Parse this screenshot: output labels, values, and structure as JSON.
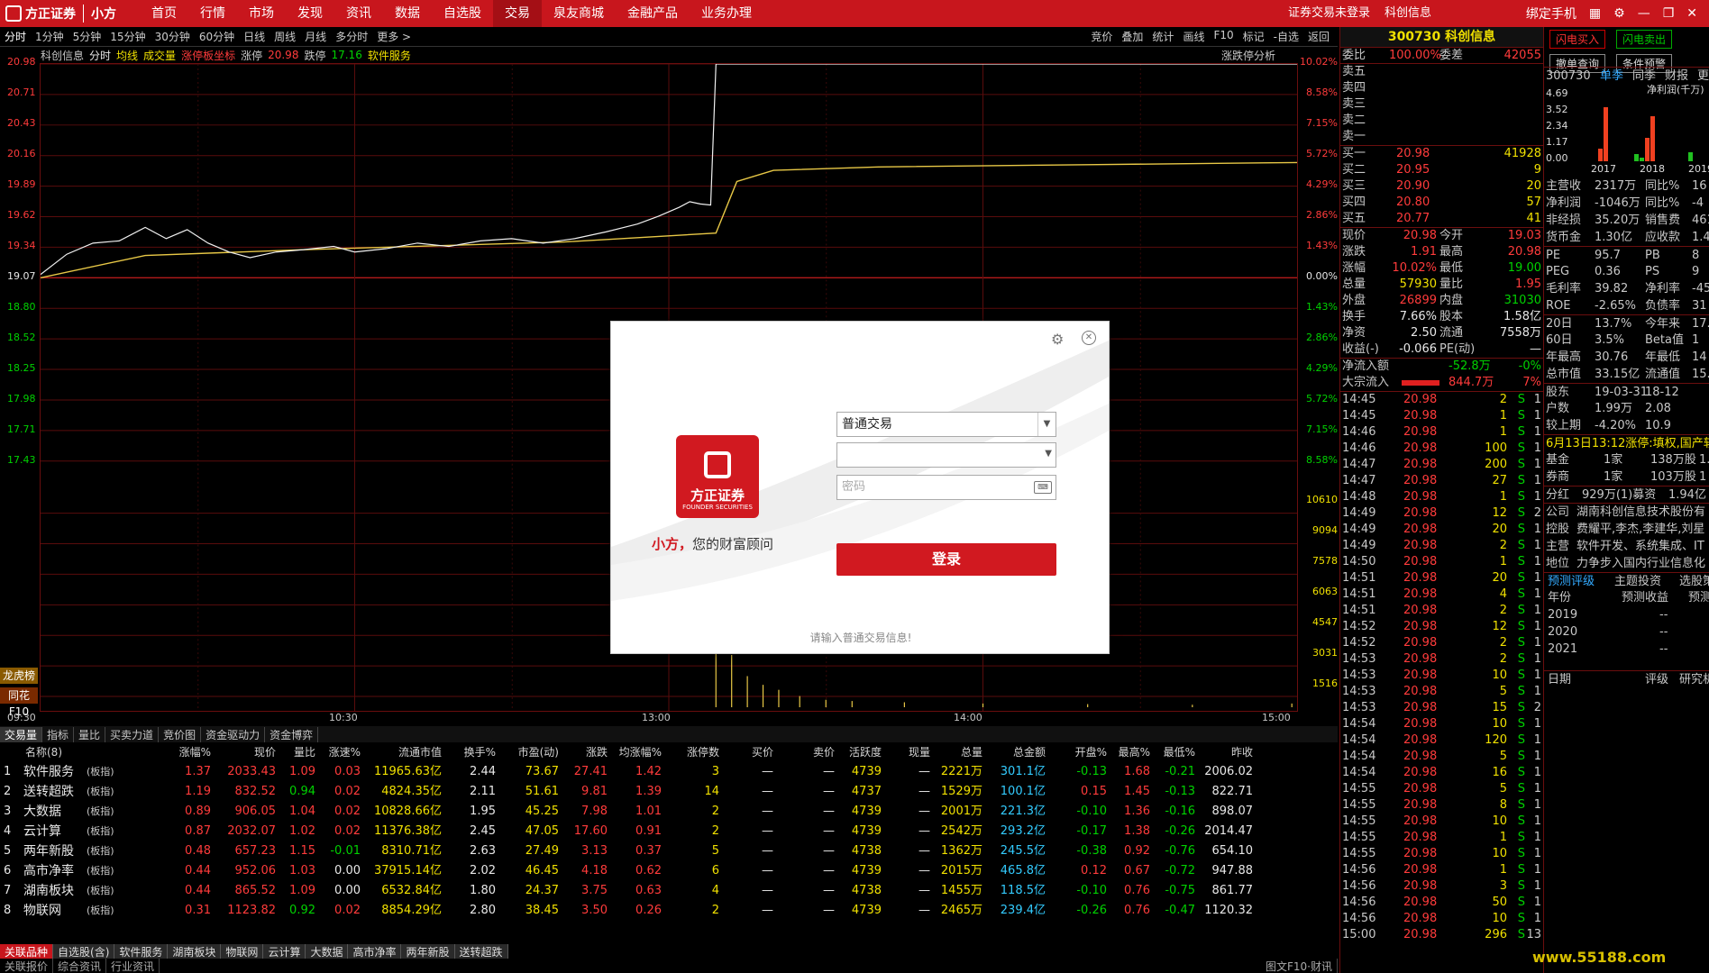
{
  "brand": {
    "name": "方正证券",
    "sub": "小方"
  },
  "nav": [
    "首页",
    "行情",
    "市场",
    "发现",
    "资讯",
    "数据",
    "自选股",
    "交易",
    "泉友商城",
    "金融产品",
    "业务办理"
  ],
  "nav_active": 7,
  "top_right": [
    "证券交易未登录",
    "科创信息"
  ],
  "win_right": "绑定手机",
  "toolbar": [
    "分时",
    "1分钟",
    "5分钟",
    "15分钟",
    "30分钟",
    "60分钟",
    "日线",
    "周线",
    "月线",
    "多分时",
    "更多 >"
  ],
  "toolbar_right": [
    "竞价",
    "叠加",
    "统计",
    "画线",
    "F10",
    "标记",
    "-自选",
    "返回"
  ],
  "infoline": {
    "a": "科创信息",
    "b": "分时",
    "c": "均线",
    "d": "成交量",
    "e": "涨停板坐标",
    "f": "涨停",
    "g": "20.98",
    "h": "跌停",
    "i": "17.16",
    "j": "软件服务",
    "k": "涨跌停分析"
  },
  "price_labels": [
    "20.98",
    "20.71",
    "20.43",
    "20.16",
    "19.89",
    "19.62",
    "19.34",
    "19.07",
    "18.80",
    "18.52",
    "18.25",
    "17.98",
    "17.71",
    "17.43"
  ],
  "pct_labels": [
    "10.02%",
    "8.58%",
    "7.15%",
    "5.72%",
    "4.29%",
    "2.86%",
    "1.43%",
    "0.00%",
    "1.43%",
    "2.86%",
    "4.29%",
    "5.72%",
    "7.15%",
    "8.58%"
  ],
  "vol_labels": [
    "10610",
    "9094",
    "7578",
    "6063",
    "4547",
    "3031",
    "1516"
  ],
  "time_labels": [
    "09:30",
    "10:30",
    "13:00",
    "14:00",
    "15:00"
  ],
  "side_badges": [
    "龙虎榜",
    "同花F10"
  ],
  "subtabs": [
    "交易量",
    "指标",
    "量比",
    "买卖力道",
    "竞价图",
    "资金驱动力",
    "资金博弈"
  ],
  "table": {
    "headers": [
      "名称(8)",
      "涨幅%",
      "现价",
      "量比",
      "涨速%",
      "流通市值",
      "换手%",
      "市盈(动)",
      "涨跌",
      "均涨幅%",
      "涨停数",
      "买价",
      "卖价",
      "活跃度",
      "现量",
      "总量",
      "总金额",
      "开盘%",
      "最高%",
      "最低%",
      "昨收"
    ],
    "rows": [
      [
        "1",
        "软件服务",
        "(板指)",
        "1.37",
        "2033.43",
        "1.09",
        "0.03",
        "11965.63亿",
        "2.44",
        "73.67",
        "27.41",
        "1.42",
        "3",
        "—",
        "—",
        "4739",
        "—",
        "2221万",
        "301.1亿",
        "-0.13",
        "1.68",
        "-0.21",
        "2006.02"
      ],
      [
        "2",
        "送转超跌",
        "(板指)",
        "1.19",
        "832.52",
        "0.94",
        "0.02",
        "4824.35亿",
        "2.11",
        "51.61",
        "9.81",
        "1.39",
        "14",
        "—",
        "—",
        "4737",
        "—",
        "1529万",
        "100.1亿",
        "0.15",
        "1.45",
        "-0.13",
        "822.71"
      ],
      [
        "3",
        "大数据",
        "(板指)",
        "0.89",
        "906.05",
        "1.04",
        "0.02",
        "10828.66亿",
        "1.95",
        "45.25",
        "7.98",
        "1.01",
        "2",
        "—",
        "—",
        "4739",
        "—",
        "2001万",
        "221.3亿",
        "-0.10",
        "1.36",
        "-0.16",
        "898.07"
      ],
      [
        "4",
        "云计算",
        "(板指)",
        "0.87",
        "2032.07",
        "1.02",
        "0.02",
        "11376.38亿",
        "2.45",
        "47.05",
        "17.60",
        "0.91",
        "2",
        "—",
        "—",
        "4739",
        "—",
        "2542万",
        "293.2亿",
        "-0.17",
        "1.38",
        "-0.26",
        "2014.47"
      ],
      [
        "5",
        "两年新股",
        "(板指)",
        "0.48",
        "657.23",
        "1.15",
        "-0.01",
        "8310.71亿",
        "2.63",
        "27.49",
        "3.13",
        "0.37",
        "5",
        "—",
        "—",
        "4738",
        "—",
        "1362万",
        "245.5亿",
        "-0.38",
        "0.92",
        "-0.76",
        "654.10"
      ],
      [
        "6",
        "高市净率",
        "(板指)",
        "0.44",
        "952.06",
        "1.03",
        "0.00",
        "37915.14亿",
        "2.02",
        "46.45",
        "4.18",
        "0.62",
        "6",
        "—",
        "—",
        "4739",
        "—",
        "2015万",
        "465.8亿",
        "0.12",
        "0.67",
        "-0.72",
        "947.88"
      ],
      [
        "7",
        "湖南板块",
        "(板指)",
        "0.44",
        "865.52",
        "1.09",
        "0.00",
        "6532.84亿",
        "1.80",
        "24.37",
        "3.75",
        "0.63",
        "4",
        "—",
        "—",
        "4738",
        "—",
        "1455万",
        "118.5亿",
        "-0.10",
        "0.76",
        "-0.75",
        "861.77"
      ],
      [
        "8",
        "物联网",
        "(板指)",
        "0.31",
        "1123.82",
        "0.92",
        "0.02",
        "8854.29亿",
        "2.80",
        "38.45",
        "3.50",
        "0.26",
        "2",
        "—",
        "—",
        "4739",
        "—",
        "2465万",
        "239.4亿",
        "-0.26",
        "0.76",
        "-0.47",
        "1120.32"
      ]
    ]
  },
  "bottom_tabs": [
    "关联品种",
    "自选股(含)",
    "软件服务",
    "湖南板块",
    "物联网",
    "云计算",
    "大数据",
    "高市净率",
    "两年新股",
    "送转超跌"
  ],
  "bottom2": [
    "关联报价",
    "综合资讯",
    "行业资讯"
  ],
  "bottom_status": [
    "图文F10·财讯"
  ],
  "quote": {
    "title": "300730 科创信息",
    "weibi": [
      "委比",
      "100.00%",
      "委差",
      "42055"
    ],
    "sells": [
      "卖五",
      "卖四",
      "卖三",
      "卖二",
      "卖一"
    ],
    "buys": [
      [
        "买一",
        "20.98",
        "41928"
      ],
      [
        "买二",
        "20.95",
        "9"
      ],
      [
        "买三",
        "20.90",
        "20"
      ],
      [
        "买四",
        "20.80",
        "57"
      ],
      [
        "买五",
        "20.77",
        "41"
      ]
    ],
    "stats": [
      [
        "现价",
        "20.98",
        "今开",
        "19.03"
      ],
      [
        "涨跌",
        "1.91",
        "最高",
        "20.98"
      ],
      [
        "涨幅",
        "10.02%",
        "最低",
        "19.00"
      ],
      [
        "总量",
        "57930",
        "量比",
        "1.95"
      ],
      [
        "外盘",
        "26899",
        "内盘",
        "31030"
      ],
      [
        "换手",
        "7.66%",
        "股本",
        "1.58亿"
      ],
      [
        "净资",
        "2.50",
        "流通",
        "7558万"
      ],
      [
        "收益(-)",
        "-0.066",
        "PE(动)",
        "—"
      ]
    ],
    "flow": [
      [
        "净流入额",
        "-52.8万",
        "-0%"
      ],
      [
        "大宗流入",
        "844.7万",
        "7%"
      ]
    ],
    "ticks": [
      [
        "14:45",
        "20.98",
        "2",
        "S",
        "1"
      ],
      [
        "14:45",
        "20.98",
        "1",
        "S",
        "1"
      ],
      [
        "14:46",
        "20.98",
        "1",
        "S",
        "1"
      ],
      [
        "14:46",
        "20.98",
        "100",
        "S",
        "1"
      ],
      [
        "14:47",
        "20.98",
        "200",
        "S",
        "1"
      ],
      [
        "14:47",
        "20.98",
        "27",
        "S",
        "1"
      ],
      [
        "14:48",
        "20.98",
        "1",
        "S",
        "1"
      ],
      [
        "14:49",
        "20.98",
        "12",
        "S",
        "2"
      ],
      [
        "14:49",
        "20.98",
        "20",
        "S",
        "1"
      ],
      [
        "14:49",
        "20.98",
        "2",
        "S",
        "1"
      ],
      [
        "14:50",
        "20.98",
        "1",
        "S",
        "1"
      ],
      [
        "14:51",
        "20.98",
        "20",
        "S",
        "1"
      ],
      [
        "14:51",
        "20.98",
        "4",
        "S",
        "1"
      ],
      [
        "14:51",
        "20.98",
        "2",
        "S",
        "1"
      ],
      [
        "14:52",
        "20.98",
        "12",
        "S",
        "1"
      ],
      [
        "14:52",
        "20.98",
        "2",
        "S",
        "1"
      ],
      [
        "14:53",
        "20.98",
        "2",
        "S",
        "1"
      ],
      [
        "14:53",
        "20.98",
        "10",
        "S",
        "1"
      ],
      [
        "14:53",
        "20.98",
        "5",
        "S",
        "1"
      ],
      [
        "14:53",
        "20.98",
        "15",
        "S",
        "2"
      ],
      [
        "14:54",
        "20.98",
        "10",
        "S",
        "1"
      ],
      [
        "14:54",
        "20.98",
        "120",
        "S",
        "1"
      ],
      [
        "14:54",
        "20.98",
        "5",
        "S",
        "1"
      ],
      [
        "14:54",
        "20.98",
        "16",
        "S",
        "1"
      ],
      [
        "14:55",
        "20.98",
        "5",
        "S",
        "1"
      ],
      [
        "14:55",
        "20.98",
        "8",
        "S",
        "1"
      ],
      [
        "14:55",
        "20.98",
        "10",
        "S",
        "1"
      ],
      [
        "14:55",
        "20.98",
        "1",
        "S",
        "1"
      ],
      [
        "14:55",
        "20.98",
        "10",
        "S",
        "1"
      ],
      [
        "14:56",
        "20.98",
        "1",
        "S",
        "1"
      ],
      [
        "14:56",
        "20.98",
        "3",
        "S",
        "1"
      ],
      [
        "14:56",
        "20.98",
        "50",
        "S",
        "1"
      ],
      [
        "14:56",
        "20.98",
        "10",
        "S",
        "1"
      ],
      [
        "15:00",
        "20.98",
        "296",
        "S",
        "13"
      ]
    ]
  },
  "far": {
    "buttons": [
      "闪电买入",
      "闪电卖出",
      "撤单查询",
      "条件预警"
    ],
    "head": [
      "300730",
      "单季",
      "同季",
      "财报",
      "更多"
    ],
    "net_profit_label": "净利润(千万)",
    "yaxis": [
      "4.69",
      "3.52",
      "2.34",
      "1.17",
      "0.00"
    ],
    "years": [
      "2017",
      "2018",
      "2019"
    ],
    "rows": [
      [
        "主营收",
        "2317万",
        "同比%",
        "16"
      ],
      [
        "净利润",
        "-1046万",
        "同比%",
        "-4"
      ],
      [
        "非经损",
        "35.20万",
        "销售费",
        "461"
      ],
      [
        "货币金",
        "1.30亿",
        "应收款",
        "1.40"
      ],
      [
        "PE",
        "95.7",
        "PB",
        "8"
      ],
      [
        "PEG",
        "0.36",
        "PS",
        "9"
      ],
      [
        "毛利率",
        "39.82",
        "净利率",
        "-45"
      ],
      [
        "ROE",
        "-2.65%",
        "负债率",
        "31"
      ],
      [
        "20日",
        "13.7%",
        "今年来",
        "17."
      ],
      [
        "60日",
        "3.5%",
        "Beta值",
        "1"
      ],
      [
        "年最高",
        "30.76",
        "年最低",
        "14"
      ],
      [
        "总市值",
        "33.15亿",
        "流通值",
        "15.86"
      ],
      [
        "股东",
        "19-03-31",
        "18-12",
        ""
      ],
      [
        "户数",
        "1.99万",
        "2.08",
        ""
      ],
      [
        "较上期",
        "-4.20%",
        "10.9",
        ""
      ]
    ],
    "news": "6月13日13:12涨停:填权,国产软",
    "inst": [
      [
        "基金",
        "1家",
        "138万股",
        "1."
      ],
      [
        "券商",
        "1家",
        "103万股",
        "1"
      ]
    ],
    "div": [
      "分红",
      "929万(1)募资",
      "1.94亿"
    ],
    "company": [
      [
        "公司",
        "湖南科创信息技术股份有"
      ],
      [
        "控股",
        "费耀平,李杰,李建华,刘星"
      ],
      [
        "主营",
        "软件开发、系统集成、IT"
      ],
      [
        "地位",
        "力争步入国内行业信息化"
      ]
    ],
    "forecast_tabs": [
      "预测评级",
      "主题投资",
      "选股策略"
    ],
    "forecast_head": [
      "年份",
      "预测收益",
      "预测"
    ],
    "forecast_years": [
      "2019",
      "2020",
      "2021"
    ],
    "rating_head": [
      "日期",
      "评级",
      "研究机"
    ]
  },
  "dialog": {
    "brand_cn": "方正证券",
    "brand_en": "FOUNDER SECURITIES",
    "slogan_a": "小方，",
    "slogan_b": "您的财富顾问",
    "mode": "普通交易",
    "account": "",
    "pwd_placeholder": "密码",
    "login": "登录",
    "hint": "请输入普通交易信息!"
  },
  "watermark": "www.55188.com",
  "chart_data": {
    "type": "line",
    "y_range": [
      17.16,
      20.98
    ],
    "prev_close": 19.07,
    "x_range": [
      0,
      240
    ],
    "price": [
      [
        0,
        19.1
      ],
      [
        5,
        19.28
      ],
      [
        10,
        19.38
      ],
      [
        15,
        19.4
      ],
      [
        20,
        19.52
      ],
      [
        24,
        19.42
      ],
      [
        28,
        19.5
      ],
      [
        32,
        19.38
      ],
      [
        36,
        19.3
      ],
      [
        40,
        19.25
      ],
      [
        45,
        19.3
      ],
      [
        50,
        19.32
      ],
      [
        56,
        19.35
      ],
      [
        60,
        19.3
      ],
      [
        66,
        19.33
      ],
      [
        72,
        19.38
      ],
      [
        78,
        19.35
      ],
      [
        84,
        19.4
      ],
      [
        90,
        19.42
      ],
      [
        96,
        19.38
      ],
      [
        102,
        19.42
      ],
      [
        108,
        19.48
      ],
      [
        114,
        19.55
      ],
      [
        118,
        19.62
      ],
      [
        122,
        19.7
      ],
      [
        124,
        19.75
      ],
      [
        126,
        19.73
      ],
      [
        128,
        19.72
      ],
      [
        129,
        20.98
      ],
      [
        140,
        20.98
      ],
      [
        200,
        20.98
      ],
      [
        240,
        20.98
      ]
    ],
    "avg": [
      [
        0,
        19.07
      ],
      [
        20,
        19.27
      ],
      [
        50,
        19.32
      ],
      [
        100,
        19.39
      ],
      [
        129,
        19.47
      ],
      [
        133,
        19.93
      ],
      [
        140,
        20.03
      ],
      [
        160,
        20.06
      ],
      [
        200,
        20.08
      ],
      [
        240,
        20.1
      ]
    ],
    "volume": [
      [
        129,
        10610
      ],
      [
        132,
        4200
      ],
      [
        135,
        2500
      ],
      [
        138,
        1800
      ],
      [
        141,
        1400
      ],
      [
        145,
        900
      ],
      [
        150,
        600
      ],
      [
        155,
        500
      ],
      [
        165,
        400
      ],
      [
        180,
        300
      ],
      [
        200,
        250
      ],
      [
        220,
        200
      ],
      [
        239,
        300
      ]
    ]
  }
}
